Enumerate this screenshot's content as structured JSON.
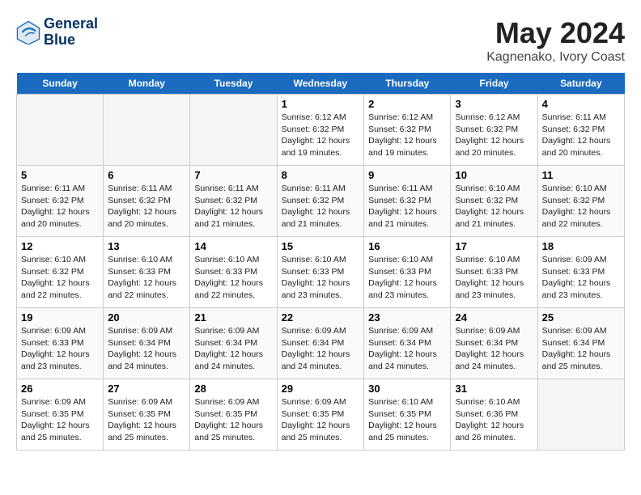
{
  "header": {
    "logo_line1": "General",
    "logo_line2": "Blue",
    "month_title": "May 2024",
    "location": "Kagnenako, Ivory Coast"
  },
  "day_headers": [
    "Sunday",
    "Monday",
    "Tuesday",
    "Wednesday",
    "Thursday",
    "Friday",
    "Saturday"
  ],
  "weeks": [
    [
      {
        "day": "",
        "info": ""
      },
      {
        "day": "",
        "info": ""
      },
      {
        "day": "",
        "info": ""
      },
      {
        "day": "1",
        "info": "Sunrise: 6:12 AM\nSunset: 6:32 PM\nDaylight: 12 hours\nand 19 minutes."
      },
      {
        "day": "2",
        "info": "Sunrise: 6:12 AM\nSunset: 6:32 PM\nDaylight: 12 hours\nand 19 minutes."
      },
      {
        "day": "3",
        "info": "Sunrise: 6:12 AM\nSunset: 6:32 PM\nDaylight: 12 hours\nand 20 minutes."
      },
      {
        "day": "4",
        "info": "Sunrise: 6:11 AM\nSunset: 6:32 PM\nDaylight: 12 hours\nand 20 minutes."
      }
    ],
    [
      {
        "day": "5",
        "info": "Sunrise: 6:11 AM\nSunset: 6:32 PM\nDaylight: 12 hours\nand 20 minutes."
      },
      {
        "day": "6",
        "info": "Sunrise: 6:11 AM\nSunset: 6:32 PM\nDaylight: 12 hours\nand 20 minutes."
      },
      {
        "day": "7",
        "info": "Sunrise: 6:11 AM\nSunset: 6:32 PM\nDaylight: 12 hours\nand 21 minutes."
      },
      {
        "day": "8",
        "info": "Sunrise: 6:11 AM\nSunset: 6:32 PM\nDaylight: 12 hours\nand 21 minutes."
      },
      {
        "day": "9",
        "info": "Sunrise: 6:11 AM\nSunset: 6:32 PM\nDaylight: 12 hours\nand 21 minutes."
      },
      {
        "day": "10",
        "info": "Sunrise: 6:10 AM\nSunset: 6:32 PM\nDaylight: 12 hours\nand 21 minutes."
      },
      {
        "day": "11",
        "info": "Sunrise: 6:10 AM\nSunset: 6:32 PM\nDaylight: 12 hours\nand 22 minutes."
      }
    ],
    [
      {
        "day": "12",
        "info": "Sunrise: 6:10 AM\nSunset: 6:32 PM\nDaylight: 12 hours\nand 22 minutes."
      },
      {
        "day": "13",
        "info": "Sunrise: 6:10 AM\nSunset: 6:33 PM\nDaylight: 12 hours\nand 22 minutes."
      },
      {
        "day": "14",
        "info": "Sunrise: 6:10 AM\nSunset: 6:33 PM\nDaylight: 12 hours\nand 22 minutes."
      },
      {
        "day": "15",
        "info": "Sunrise: 6:10 AM\nSunset: 6:33 PM\nDaylight: 12 hours\nand 23 minutes."
      },
      {
        "day": "16",
        "info": "Sunrise: 6:10 AM\nSunset: 6:33 PM\nDaylight: 12 hours\nand 23 minutes."
      },
      {
        "day": "17",
        "info": "Sunrise: 6:10 AM\nSunset: 6:33 PM\nDaylight: 12 hours\nand 23 minutes."
      },
      {
        "day": "18",
        "info": "Sunrise: 6:09 AM\nSunset: 6:33 PM\nDaylight: 12 hours\nand 23 minutes."
      }
    ],
    [
      {
        "day": "19",
        "info": "Sunrise: 6:09 AM\nSunset: 6:33 PM\nDaylight: 12 hours\nand 23 minutes."
      },
      {
        "day": "20",
        "info": "Sunrise: 6:09 AM\nSunset: 6:34 PM\nDaylight: 12 hours\nand 24 minutes."
      },
      {
        "day": "21",
        "info": "Sunrise: 6:09 AM\nSunset: 6:34 PM\nDaylight: 12 hours\nand 24 minutes."
      },
      {
        "day": "22",
        "info": "Sunrise: 6:09 AM\nSunset: 6:34 PM\nDaylight: 12 hours\nand 24 minutes."
      },
      {
        "day": "23",
        "info": "Sunrise: 6:09 AM\nSunset: 6:34 PM\nDaylight: 12 hours\nand 24 minutes."
      },
      {
        "day": "24",
        "info": "Sunrise: 6:09 AM\nSunset: 6:34 PM\nDaylight: 12 hours\nand 24 minutes."
      },
      {
        "day": "25",
        "info": "Sunrise: 6:09 AM\nSunset: 6:34 PM\nDaylight: 12 hours\nand 25 minutes."
      }
    ],
    [
      {
        "day": "26",
        "info": "Sunrise: 6:09 AM\nSunset: 6:35 PM\nDaylight: 12 hours\nand 25 minutes."
      },
      {
        "day": "27",
        "info": "Sunrise: 6:09 AM\nSunset: 6:35 PM\nDaylight: 12 hours\nand 25 minutes."
      },
      {
        "day": "28",
        "info": "Sunrise: 6:09 AM\nSunset: 6:35 PM\nDaylight: 12 hours\nand 25 minutes."
      },
      {
        "day": "29",
        "info": "Sunrise: 6:09 AM\nSunset: 6:35 PM\nDaylight: 12 hours\nand 25 minutes."
      },
      {
        "day": "30",
        "info": "Sunrise: 6:10 AM\nSunset: 6:35 PM\nDaylight: 12 hours\nand 25 minutes."
      },
      {
        "day": "31",
        "info": "Sunrise: 6:10 AM\nSunset: 6:36 PM\nDaylight: 12 hours\nand 26 minutes."
      },
      {
        "day": "",
        "info": ""
      }
    ]
  ]
}
